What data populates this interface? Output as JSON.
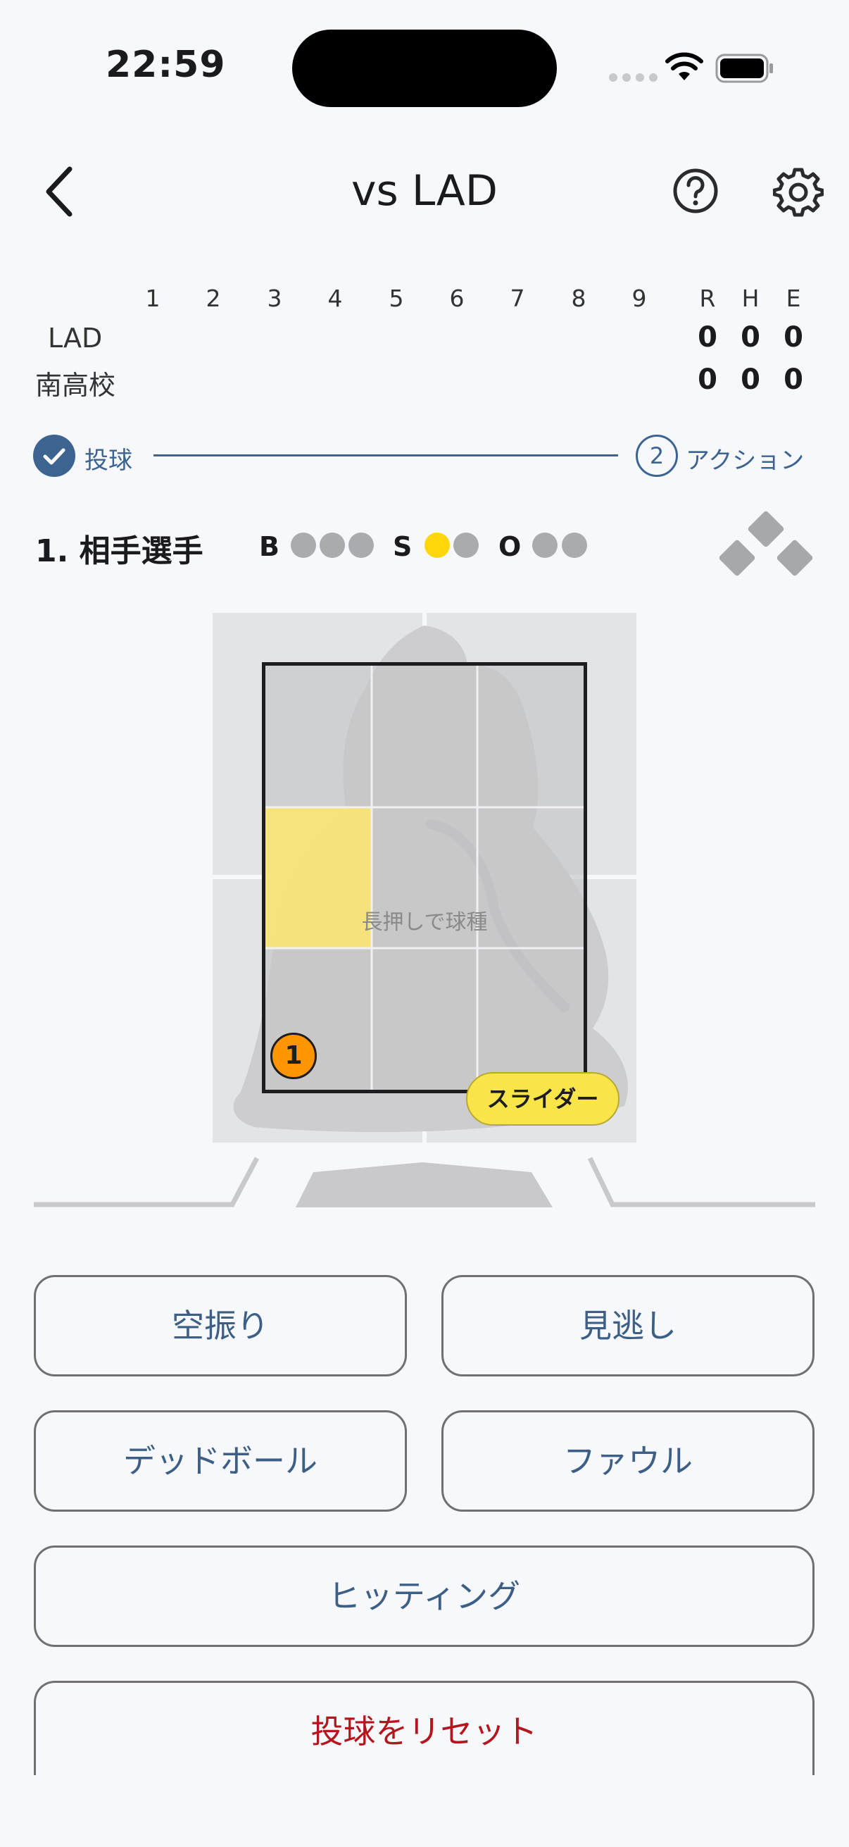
{
  "status_bar": {
    "time": "22:59"
  },
  "header": {
    "title": "vs  LAD"
  },
  "scoreboard": {
    "innings": [
      "1",
      "2",
      "3",
      "4",
      "5",
      "6",
      "7",
      "8",
      "9"
    ],
    "total_headers": [
      "R",
      "H",
      "E"
    ],
    "teams": [
      {
        "name": "LAD",
        "totals": [
          "0",
          "0",
          "0"
        ]
      },
      {
        "name": "南高校",
        "totals": [
          "0",
          "0",
          "0"
        ]
      }
    ]
  },
  "stepper": {
    "step1_label": "投球",
    "step2_number": "2",
    "step2_label": "アクション"
  },
  "count": {
    "batter": "1. 相手選手",
    "ball_label": "B",
    "strike_label": "S",
    "out_label": "O",
    "balls": 0,
    "strikes": 1,
    "outs": 0
  },
  "zone": {
    "hint": "長押しで球種",
    "pitch_number": "1",
    "pitch_type": "スライダー",
    "highlight_color": "#fde66f"
  },
  "actions": {
    "swing_miss": "空振り",
    "looking": "見逃し",
    "hit_by_pitch": "デッドボール",
    "foul": "ファウル",
    "hitting": "ヒッティング",
    "reset": "投球をリセット"
  },
  "colors": {
    "accent": "#3d6391",
    "button_text": "#3d5f86",
    "reset_text": "#b3171d",
    "strike_on": "#ffd60a",
    "pitch_marker": "#ff9500"
  }
}
